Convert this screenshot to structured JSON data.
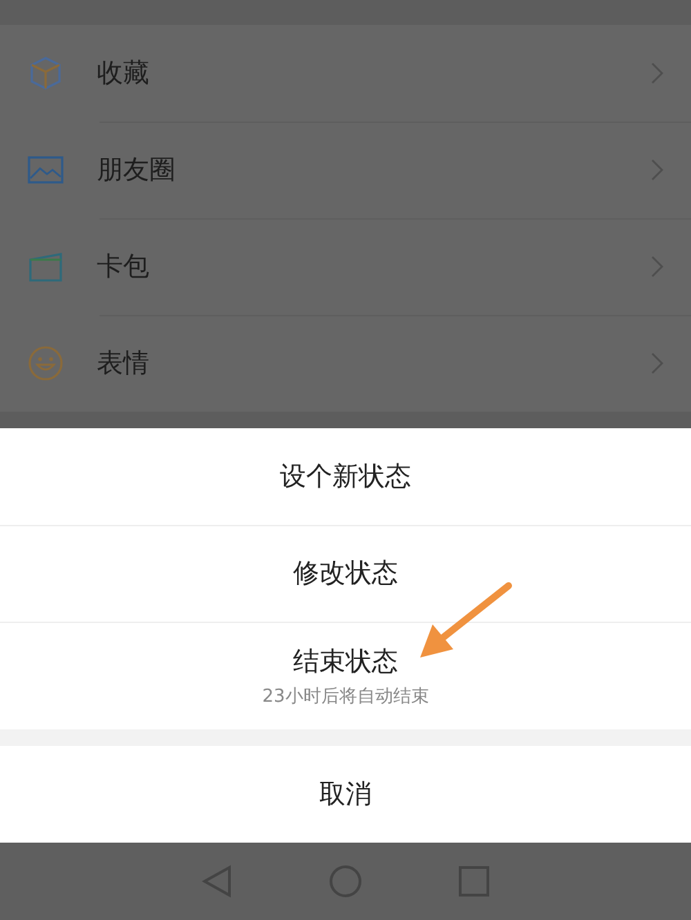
{
  "menu": [
    {
      "label": "收藏"
    },
    {
      "label": "朋友圈"
    },
    {
      "label": "卡包"
    },
    {
      "label": "表情"
    }
  ],
  "action_sheet": {
    "options": [
      {
        "label": "设个新状态"
      },
      {
        "label": "修改状态"
      },
      {
        "label": "结束状态",
        "subtitle": "23小时后将自动结束"
      }
    ],
    "cancel": "取消"
  }
}
